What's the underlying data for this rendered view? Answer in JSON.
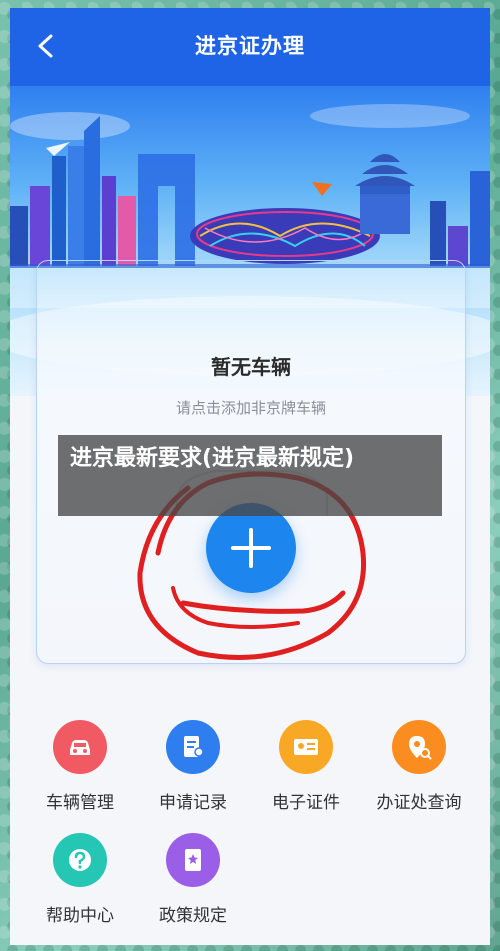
{
  "header": {
    "title": "进京证办理",
    "back_icon": "chevron-left-icon"
  },
  "card": {
    "heading": "暂无车辆",
    "subtext": "请点击添加非京牌车辆",
    "add_icon": "plus-icon"
  },
  "overlay": {
    "text": "进京最新要求(进京最新规定)"
  },
  "menu": {
    "items": [
      {
        "label": "车辆管理",
        "icon": "car-icon",
        "color": "#f25a63"
      },
      {
        "label": "申请记录",
        "icon": "document-icon",
        "color": "#2f7ef0"
      },
      {
        "label": "电子证件",
        "icon": "id-card-icon",
        "color": "#f9a825"
      },
      {
        "label": "办证处查询",
        "icon": "location-search-icon",
        "color": "#fb8c1f"
      },
      {
        "label": "帮助中心",
        "icon": "question-icon",
        "color": "#26c6b4"
      },
      {
        "label": "政策规定",
        "icon": "policy-book-icon",
        "color": "#9b5ee6"
      }
    ]
  },
  "colors": {
    "header_blue": "#1f64e6",
    "add_button_blue": "#1d86ee",
    "annotation_red": "#e02020"
  }
}
